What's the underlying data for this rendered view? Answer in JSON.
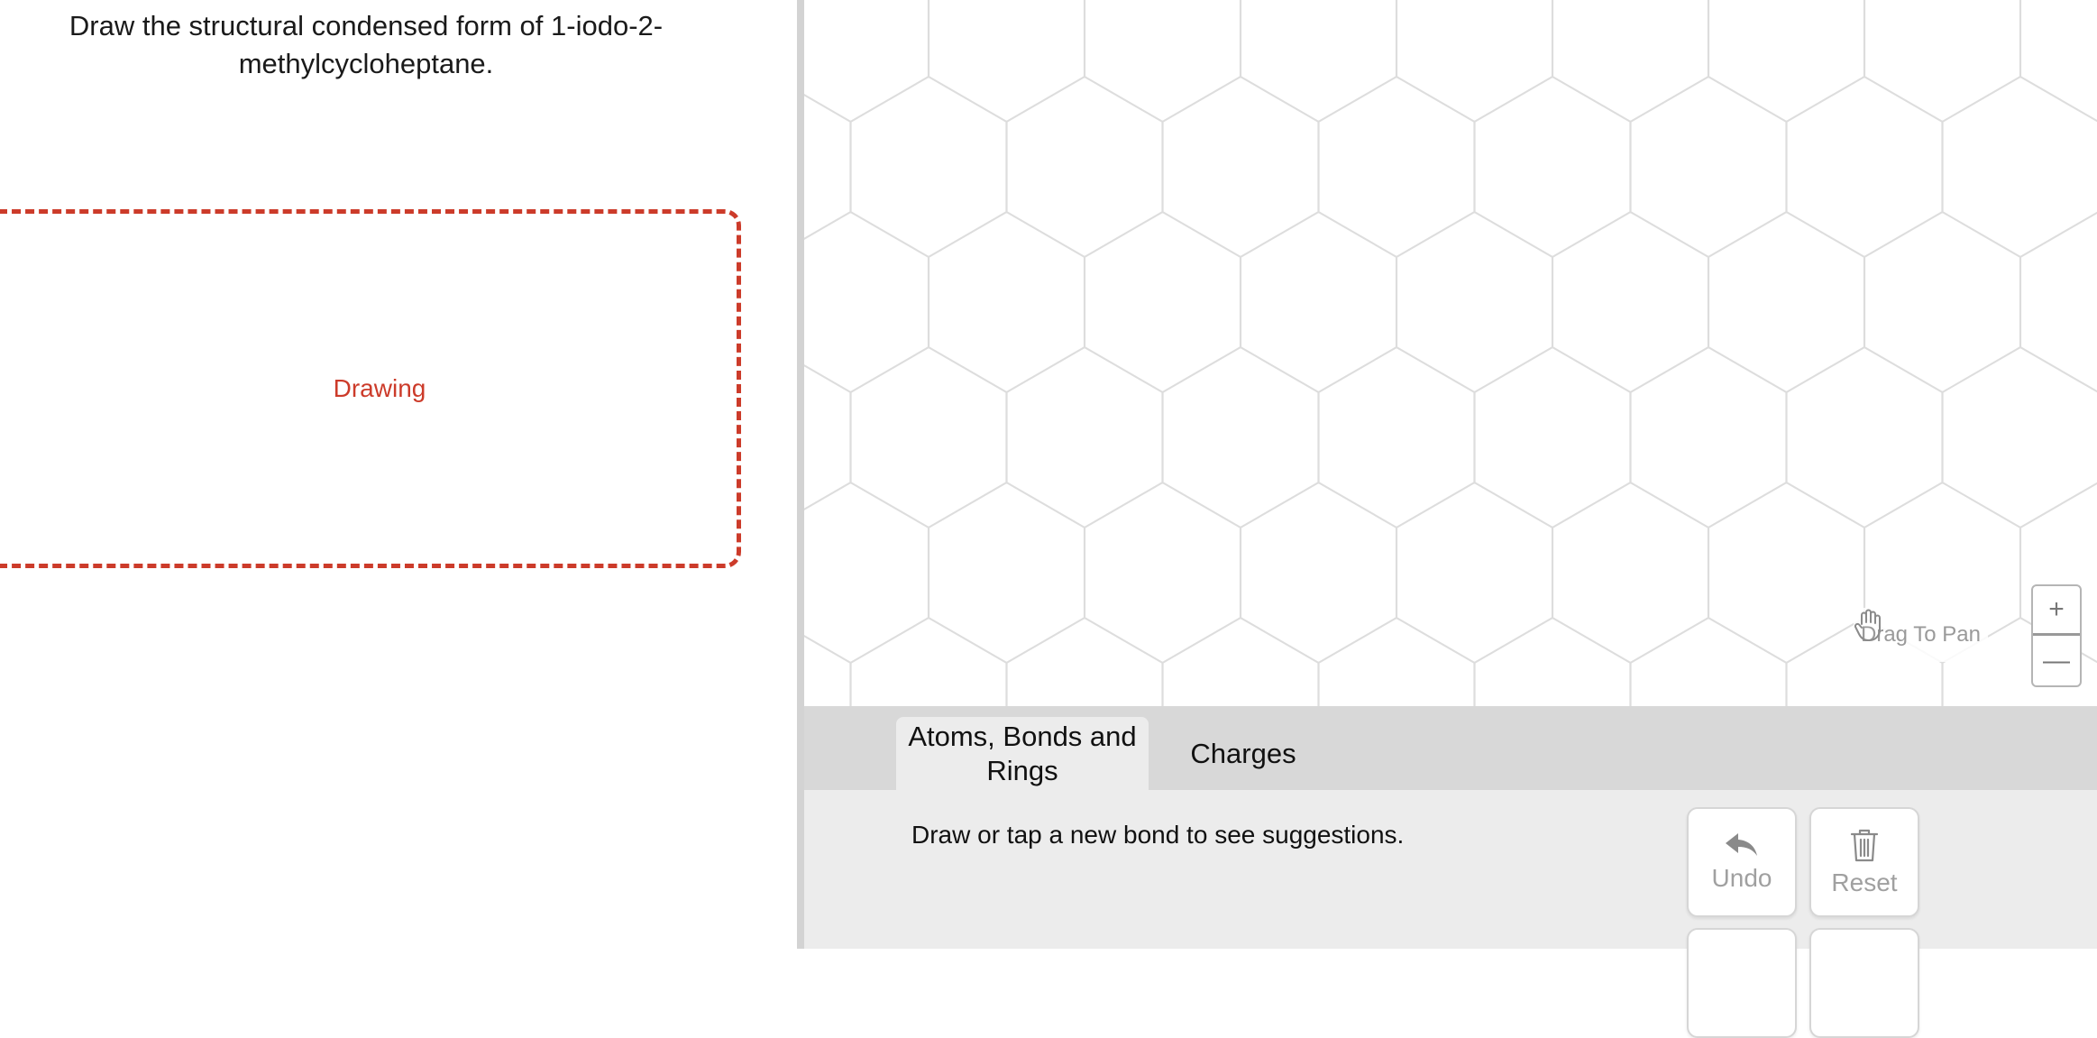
{
  "question": {
    "text": "Draw the structural condensed form of 1-iodo-2-methylcycloheptane."
  },
  "drawing_area": {
    "label": "Drawing"
  },
  "canvas": {
    "pan_label": "Drag To Pan",
    "zoom_in_label": "+",
    "zoom_out_label": "—"
  },
  "tabs": [
    {
      "label": "Atoms, Bonds and Rings",
      "active": true
    },
    {
      "label": "Charges",
      "active": false
    }
  ],
  "tool_panel": {
    "hint": "Draw or tap a new bond to see suggestions.",
    "undo_label": "Undo",
    "reset_label": "Reset"
  },
  "icons": {
    "pan": "hand-icon",
    "undo": "undo-arrow-icon",
    "reset": "trash-icon"
  },
  "colors": {
    "accent": "#cc3b2a",
    "grid": "#dddddd",
    "toolbar": "#d8d8d8",
    "panel": "#ececec"
  }
}
